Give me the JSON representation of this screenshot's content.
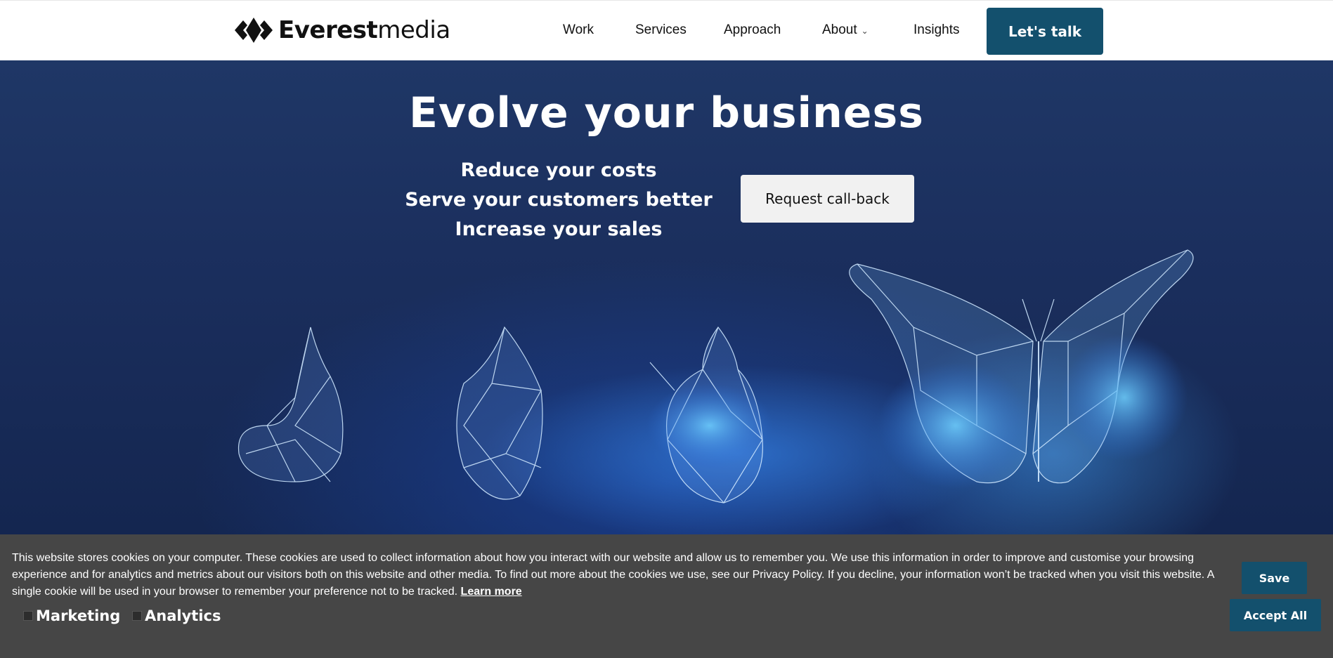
{
  "brand": {
    "name_bold": "Everest",
    "name_light": "media",
    "logo_icon": "diamond-logo-icon"
  },
  "nav": {
    "items": [
      {
        "label": "Work"
      },
      {
        "label": "Services"
      },
      {
        "label": "Approach"
      },
      {
        "label": "About",
        "has_dropdown": true
      },
      {
        "label": "Insights"
      }
    ],
    "cta_label": "Let's talk"
  },
  "hero": {
    "title": "Evolve your business",
    "benefits": [
      "Reduce your costs",
      "Serve your customers better",
      "Increase your sales"
    ],
    "callback_label": "Request call-back",
    "illustration": "butterfly-lifecycle-image"
  },
  "cookie": {
    "text": "This website stores cookies on your computer. These cookies are used to collect information about how you interact with our website and allow us to remember you. We use this information in order to improve and customise your browsing experience and for analytics and metrics about our visitors both on this website and other media. To find out more about the cookies we use, see our Privacy Policy. If you decline, your information won’t be tracked when you visit this website. A single cookie will be used in your browser to remember your preference not to be tracked.",
    "learn_more": "Learn more",
    "options": [
      {
        "label": "Marketing",
        "checked": false
      },
      {
        "label": "Analytics",
        "checked": false
      }
    ],
    "save_label": "Save",
    "accept_label": "Accept All"
  },
  "colors": {
    "accent": "#13506d",
    "hero_bg": "#1b2f5e",
    "banner_bg": "#464646"
  }
}
